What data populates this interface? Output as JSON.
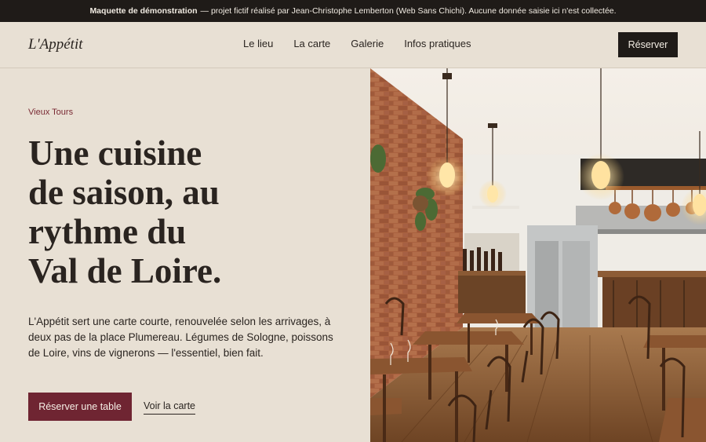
{
  "banner": {
    "strong": "Maquette de démonstration",
    "text": "— projet fictif réalisé par Jean-Christophe Lemberton (Web Sans Chichi). Aucune donnée saisie ici n'est collectée."
  },
  "nav": {
    "logo": "L'Appétit",
    "items": [
      "Le lieu",
      "La carte",
      "Galerie",
      "Infos pratiques"
    ],
    "cta": "Réserver"
  },
  "hero": {
    "eyebrow": "Vieux Tours",
    "headline_lines": [
      "Une cuisine",
      "de saison, au",
      "rythme du",
      "Val de Loire."
    ],
    "lede": "L'Appétit sert une carte courte, renouvelée selon les arrivages, à deux pas de la place Plumereau. Légumes de Sologne, poissons de Loire, vins de vignerons — l'essentiel, bien fait.",
    "primary_cta": "Réserver une table",
    "secondary_cta": "Voir la carte",
    "image_icon": "restaurant-interior-photo"
  },
  "colors": {
    "background": "#e8e0d4",
    "banner": "#1f1b18",
    "accent": "#6f2532",
    "text": "#2a2420"
  }
}
